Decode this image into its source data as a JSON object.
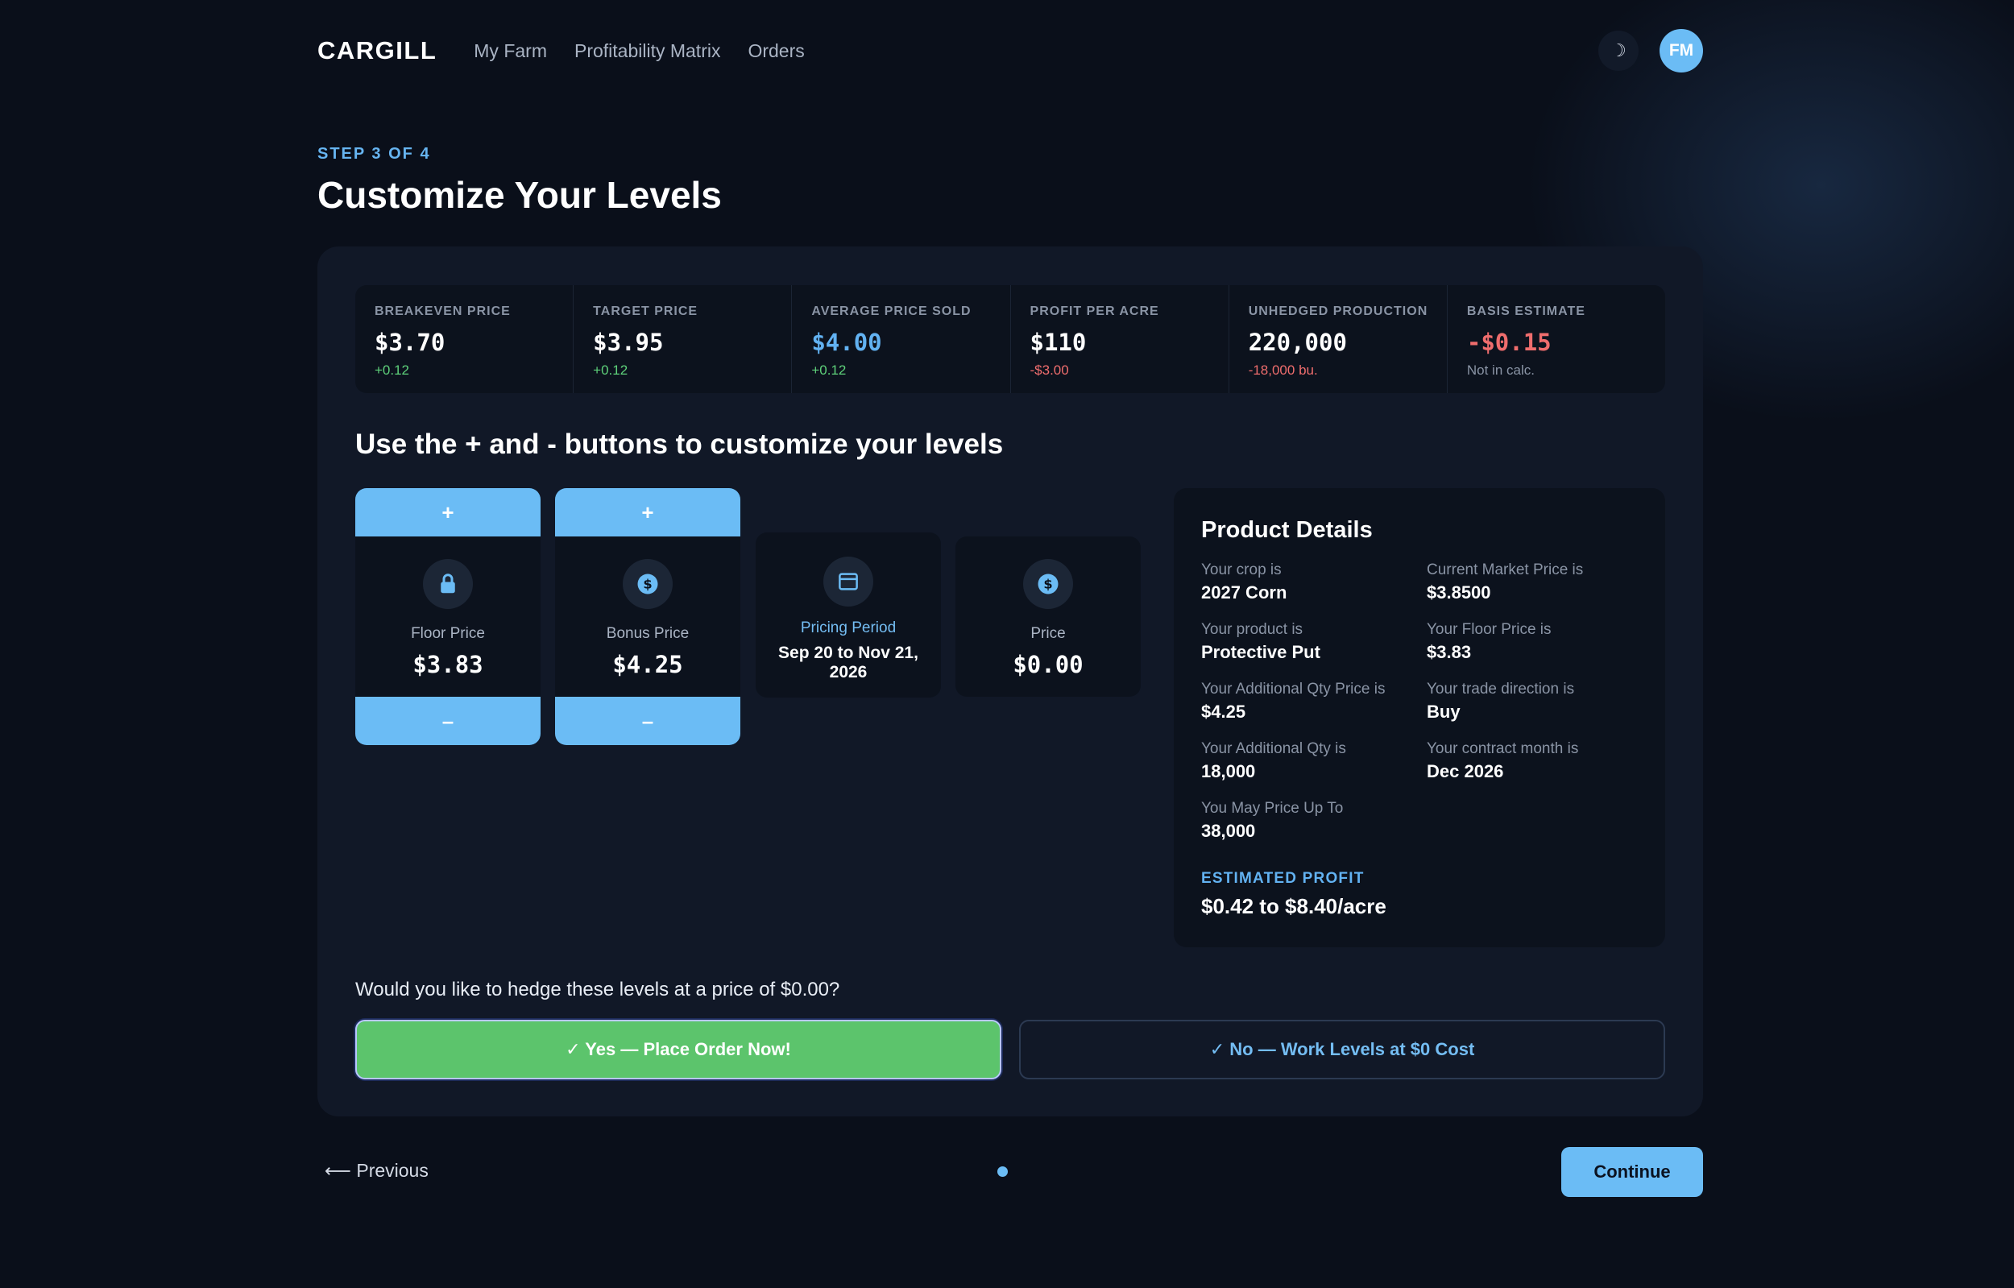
{
  "header": {
    "logo": "CARGILL",
    "nav": [
      "My Farm",
      "Profitability Matrix",
      "Orders"
    ],
    "theme_icon": "☽",
    "avatar_initials": "FM"
  },
  "step_label": "STEP 3 OF 4",
  "page_title": "Customize Your Levels",
  "stats": [
    {
      "label": "BREAKEVEN PRICE",
      "value": "$3.70",
      "sub": "+0.12"
    },
    {
      "label": "TARGET PRICE",
      "value": "$3.95",
      "sub": "+0.12"
    },
    {
      "label": "AVERAGE PRICE SOLD",
      "value": "$4.00",
      "sub": "+0.12"
    },
    {
      "label": "PROFIT PER ACRE",
      "value": "$110",
      "sub": "-$3.00"
    },
    {
      "label": "UNHEDGED PRODUCTION",
      "value": "220,000",
      "sub": "-18,000 bu."
    },
    {
      "label": "BASIS ESTIMATE",
      "value": "-$0.15",
      "sub": "Not in calc."
    }
  ],
  "instructions": "Use the + and - buttons to customize your levels",
  "levels": {
    "plus_label": "+",
    "minus_label": "–",
    "floor": {
      "label": "Floor Price",
      "value": "$3.83"
    },
    "bonus": {
      "label": "Bonus Price",
      "value": "$4.25"
    },
    "period": {
      "label": "Pricing Period",
      "value": "Sep 20 to Nov 21, 2026"
    },
    "price": {
      "label": "Price",
      "value": "$0.00"
    }
  },
  "details": {
    "title": "Product Details",
    "items": [
      {
        "label": "Your crop is",
        "value": "2027 Corn"
      },
      {
        "label": "Current Market Price is",
        "value": "$3.8500"
      },
      {
        "label": "Your product is",
        "value": "Protective Put"
      },
      {
        "label": "Your Floor Price is",
        "value": "$3.83"
      },
      {
        "label": "Your Additional Qty Price is",
        "value": "$4.25"
      },
      {
        "label": "Your trade direction is",
        "value": "Buy"
      },
      {
        "label": "Your Additional Qty is",
        "value": "18,000"
      },
      {
        "label": "Your contract month is",
        "value": "Dec 2026"
      },
      {
        "label": "You May Price Up To",
        "value": "38,000"
      }
    ],
    "estimated_label": "ESTIMATED PROFIT",
    "estimated_value": "$0.42 to $8.40/acre"
  },
  "hedge": {
    "question": "Would you like to hedge these levels at a price of $0.00?",
    "yes_label": "✓ Yes — Place Order Now!",
    "no_label": "✓ No — Work Levels at $0 Cost"
  },
  "footer": {
    "previous_label": "⟵ Previous",
    "continue_label": "Continue"
  }
}
